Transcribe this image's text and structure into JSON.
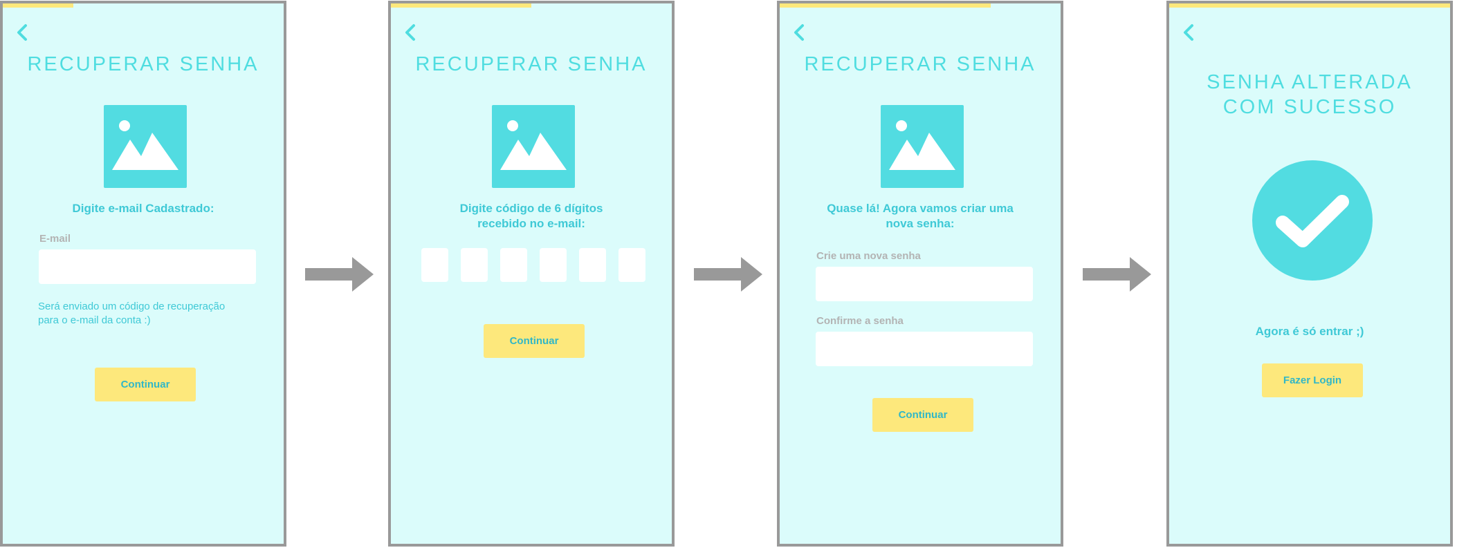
{
  "screens": [
    {
      "title": "RECUPERAR SENHA",
      "prompt": "Digite e-mail Cadastrado:",
      "email_label": "E-mail",
      "email_value": "",
      "email_placeholder": "",
      "note": "Será enviado um código de recuperação\npara o e-mail da conta :)",
      "button": "Continuar",
      "progress": 0.25
    },
    {
      "title": "RECUPERAR SENHA",
      "prompt": "Digite código de 6 dígitos\nrecebido no e-mail:",
      "code_digits": [
        "",
        "",
        "",
        "",
        "",
        ""
      ],
      "button": "Continuar",
      "progress": 0.5
    },
    {
      "title": "RECUPERAR SENHA",
      "prompt": "Quase lá! Agora vamos criar uma\nnova senha:",
      "new_password_label": "Crie uma nova senha",
      "new_password_value": "",
      "confirm_password_label": "Confirme a senha",
      "confirm_password_value": "",
      "button": "Continuar",
      "progress": 0.75
    },
    {
      "title": "SENHA ALTERADA\nCOM SUCESSO",
      "message": "Agora é só entrar ;)",
      "button": "Fazer Login",
      "progress": 1.0
    }
  ],
  "icons": {
    "back": "chevron-left-icon",
    "image": "image-placeholder-icon",
    "success": "checkmark-icon",
    "arrow": "arrow-right-icon"
  },
  "colors": {
    "screen_background": "#dbfcfb",
    "accent": "#4fdde0",
    "text_accent": "#3fc9d6",
    "button": "#fde87c",
    "button_text": "#31b7c7",
    "frame_border": "#999999",
    "arrow": "#999999",
    "label": "#b3b3b3"
  }
}
